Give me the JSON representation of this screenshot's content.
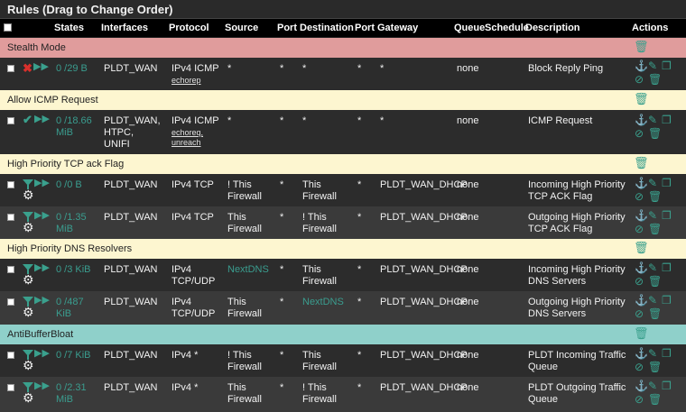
{
  "title": "Rules (Drag to Change Order)",
  "columns": {
    "states": "States",
    "interfaces": "Interfaces",
    "protocol": "Protocol",
    "source": "Source",
    "port": "Port",
    "destination": "Destination",
    "port2": "Port",
    "gateway": "Gateway",
    "queue": "Queue",
    "schedule": "Schedule",
    "description": "Description",
    "actions": "Actions"
  },
  "separators": {
    "stealth": "Stealth Mode",
    "icmp": "Allow ICMP Request",
    "tcp": "High Priority TCP ack Flag",
    "dns": "High Priority DNS Resolvers",
    "abb": "AntiBufferBloat"
  },
  "colors": {
    "sep_red": "#e09c9c",
    "sep_yellow": "#fdf6d0",
    "sep_teal": "#8fd0ca",
    "accent": "#3aa08d",
    "block": "#d9302c"
  },
  "rules": [
    {
      "states": "0 /29 B",
      "interfaces": "PLDT_WAN",
      "protocol": "IPv4 ICMP",
      "protocol_link": "echorep",
      "source": "*",
      "port": "*",
      "destination": "*",
      "port2": "*",
      "gateway": "*",
      "queue": "none",
      "description": "Block Reply Ping"
    },
    {
      "states_1": "0 /18.66",
      "states_2": "MiB",
      "interfaces_1": "PLDT_WAN,",
      "interfaces_2": "HTPC,",
      "interfaces_3": "UNIFI",
      "protocol": "IPv4 ICMP",
      "protocol_link_1": "echoreq,",
      "protocol_link_2": "unreach",
      "source": "*",
      "port": "*",
      "destination": "*",
      "port2": "*",
      "gateway": "*",
      "queue": "none",
      "description": "ICMP Request"
    },
    {
      "states": "0 /0 B",
      "interfaces": "PLDT_WAN",
      "protocol": "IPv4 TCP",
      "source_1": "! This",
      "source_2": "Firewall",
      "port": "*",
      "destination_1": "This",
      "destination_2": "Firewall",
      "port2": "*",
      "gateway": "PLDT_WAN_DHCP",
      "queue": "none",
      "description_1": "Incoming High Priority",
      "description_2": "TCP ACK Flag"
    },
    {
      "states_1": "0 /1.35",
      "states_2": "MiB",
      "interfaces": "PLDT_WAN",
      "protocol": "IPv4 TCP",
      "source_1": "This",
      "source_2": "Firewall",
      "port": "*",
      "destination_1": "! This",
      "destination_2": "Firewall",
      "port2": "*",
      "gateway": "PLDT_WAN_DHCP",
      "queue": "none",
      "description_1": "Outgoing High Priority",
      "description_2": "TCP ACK Flag"
    },
    {
      "states": "0 /3 KiB",
      "interfaces": "PLDT_WAN",
      "protocol_1": "IPv4",
      "protocol_2": "TCP/UDP",
      "source": "NextDNS",
      "port": "*",
      "destination_1": "This",
      "destination_2": "Firewall",
      "port2": "*",
      "gateway": "PLDT_WAN_DHCP",
      "queue": "none",
      "description_1": "Incoming High Priority",
      "description_2": "DNS Servers"
    },
    {
      "states_1": "0 /487",
      "states_2": "KiB",
      "interfaces": "PLDT_WAN",
      "protocol_1": "IPv4",
      "protocol_2": "TCP/UDP",
      "source_1": "This",
      "source_2": "Firewall",
      "port": "*",
      "destination": "NextDNS",
      "port2": "*",
      "gateway": "PLDT_WAN_DHCP",
      "queue": "none",
      "description_1": "Outgoing High Priority",
      "description_2": "DNS Servers"
    },
    {
      "states": "0 /7 KiB",
      "interfaces": "PLDT_WAN",
      "protocol": "IPv4 *",
      "source_1": "! This",
      "source_2": "Firewall",
      "port": "*",
      "destination_1": "This",
      "destination_2": "Firewall",
      "port2": "*",
      "gateway": "PLDT_WAN_DHCP",
      "queue": "none",
      "description_1": "PLDT Incoming Traffic",
      "description_2": "Queue"
    },
    {
      "states_1": "0 /2.31",
      "states_2": "MiB",
      "interfaces": "PLDT_WAN",
      "protocol": "IPv4 *",
      "source_1": "This",
      "source_2": "Firewall",
      "port": "*",
      "destination_1": "! This",
      "destination_2": "Firewall",
      "port2": "*",
      "gateway": "PLDT_WAN_DHCP",
      "queue": "none",
      "description_1": "PLDT Outgoing Traffic",
      "description_2": "Queue"
    }
  ],
  "icons": {
    "block": "block-x-icon",
    "pass": "pass-check-icon",
    "log": "log-arrows-icon",
    "queue": "queue-funnel-icon",
    "advanced": "gear-icon",
    "anchor": "anchor-icon",
    "edit": "pencil-icon",
    "copy": "copy-icon",
    "disable": "disable-icon",
    "delete": "trash-icon"
  }
}
